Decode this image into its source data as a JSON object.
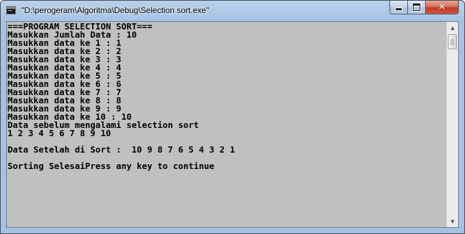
{
  "window": {
    "title": "\"D:\\perogeram\\Algoritma\\Debug\\Selection sort.exe\"",
    "icons": {
      "app": "console-app-icon",
      "minimize": "minimize-icon",
      "maximize": "maximize-icon",
      "close": "close-icon"
    },
    "close_glyph": "✕"
  },
  "console": {
    "background": "#c0c0c0",
    "foreground": "#000000",
    "lines": [
      "===PROGRAM SELECTION SORT===",
      "Masukkan Jumlah Data : 10",
      "Masukkan data ke 1 : 1",
      "Masukkan data ke 2 : 2",
      "Masukkan data ke 3 : 3",
      "Masukkan data ke 4 : 4",
      "Masukkan data ke 5 : 5",
      "Masukkan data ke 6 : 6",
      "Masukkan data ke 7 : 7",
      "Masukkan data ke 8 : 8",
      "Masukkan data ke 9 : 9",
      "Masukkan data ke 10 : 10",
      "Data sebelum mengalami selection sort",
      "1 2 3 4 5 6 7 8 9 10",
      "",
      "Data Setelah di Sort :  10 9 8 7 6 5 4 3 2 1",
      "",
      "Sorting SelesaiPress any key to continue"
    ]
  },
  "scrollbar": {
    "up_glyph": "▲",
    "down_glyph": "▼",
    "position": 0
  }
}
